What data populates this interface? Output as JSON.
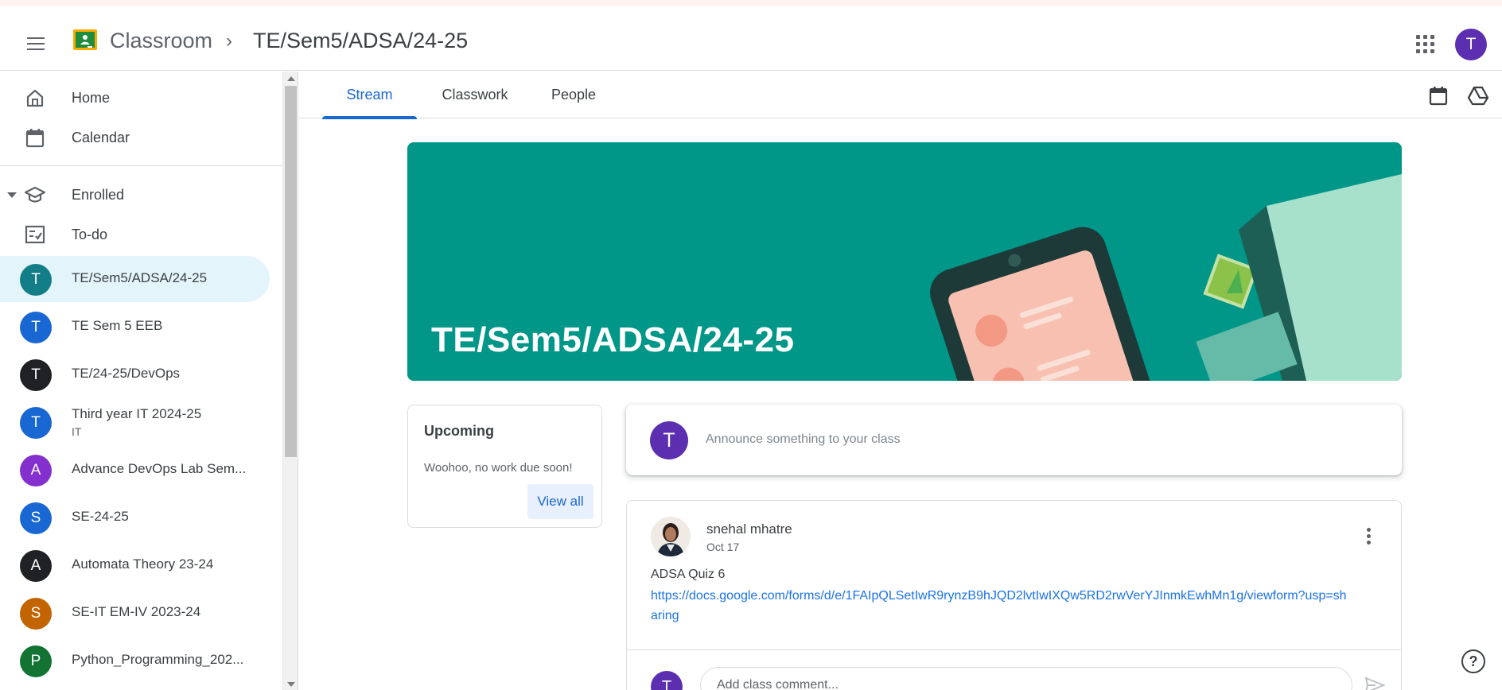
{
  "header": {
    "app_name": "Classroom",
    "crumb_separator": "›",
    "class_crumb": "TE/Sem5/ADSA/24-25",
    "account_initial": "T"
  },
  "sidebar": {
    "home": "Home",
    "calendar": "Calendar",
    "enrolled": "Enrolled",
    "todo": "To-do",
    "classes": [
      {
        "initial": "T",
        "name": "TE/Sem5/ADSA/24-25",
        "sub": "",
        "color": "#137e88",
        "active": true
      },
      {
        "initial": "T",
        "name": "TE Sem 5 EEB",
        "sub": "",
        "color": "#1967d2",
        "active": false
      },
      {
        "initial": "T",
        "name": "TE/24-25/DevOps",
        "sub": "",
        "color": "#202124",
        "active": false
      },
      {
        "initial": "T",
        "name": "Third year IT 2024-25",
        "sub": "IT",
        "color": "#1967d2",
        "active": false
      },
      {
        "initial": "A",
        "name": "Advance DevOps Lab Sem...",
        "sub": "",
        "color": "#8430ce",
        "active": false
      },
      {
        "initial": "S",
        "name": "SE-24-25",
        "sub": "",
        "color": "#1967d2",
        "active": false
      },
      {
        "initial": "A",
        "name": "Automata Theory 23-24",
        "sub": "",
        "color": "#202124",
        "active": false
      },
      {
        "initial": "S",
        "name": "SE-IT EM-IV 2023-24",
        "sub": "",
        "color": "#c26401",
        "active": false
      },
      {
        "initial": "P",
        "name": "Python_Programming_202...",
        "sub": "",
        "color": "#137333",
        "active": false
      }
    ]
  },
  "tabs": [
    {
      "label": "Stream",
      "active": true
    },
    {
      "label": "Classwork",
      "active": false
    },
    {
      "label": "People",
      "active": false
    }
  ],
  "banner": {
    "title": "TE/Sem5/ADSA/24-25",
    "color": "#009688"
  },
  "upcoming": {
    "title": "Upcoming",
    "text": "Woohoo, no work due soon!",
    "view_all": "View all"
  },
  "announce": {
    "initial": "T",
    "placeholder": "Announce something to your class"
  },
  "post": {
    "author": "snehal mhatre",
    "date": "Oct 17",
    "title": "ADSA Quiz 6",
    "link": "https://docs.google.com/forms/d/e/1FAIpQLSetIwR9rynzB9hJQD2lvtIwIXQw5RD2rwVerYJInmkEwhMn1g/viewform?usp=sharing",
    "comment_initial": "T",
    "comment_placeholder": "Add class comment..."
  },
  "colors": {
    "accent": "#1967d2",
    "account": "#5b2fb0"
  }
}
